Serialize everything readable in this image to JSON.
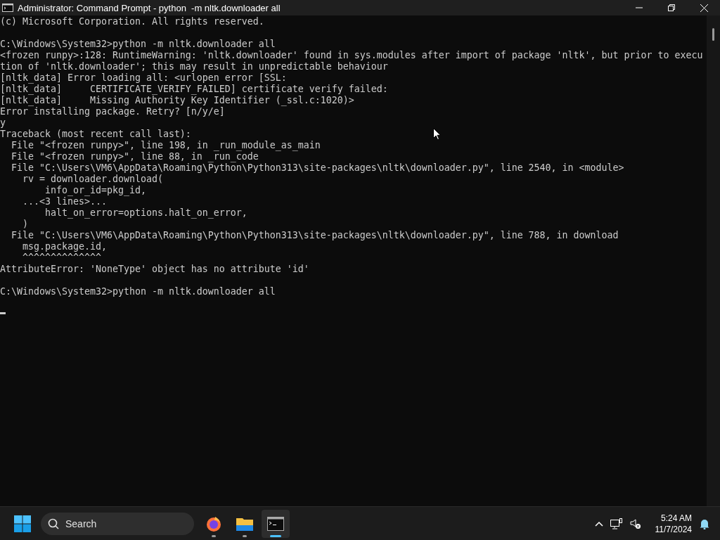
{
  "window": {
    "title": "Administrator: Command Prompt - python  -m nltk.downloader all"
  },
  "terminal": {
    "lines": [
      {
        "kind": "text",
        "text": "(c) Microsoft Corporation. All rights reserved."
      },
      {
        "kind": "blank"
      },
      {
        "kind": "text",
        "text": "C:\\Windows\\System32>python -m nltk.downloader all"
      },
      {
        "kind": "text",
        "text": "<frozen runpy>:128: RuntimeWarning: 'nltk.downloader' found in sys.modules after import of package 'nltk', but prior to execu"
      },
      {
        "kind": "text",
        "text": "tion of 'nltk.downloader'; this may result in unpredictable behaviour"
      },
      {
        "kind": "text",
        "text": "[nltk_data] Error loading all: <urlopen error [SSL:"
      },
      {
        "kind": "text",
        "text": "[nltk_data]     CERTIFICATE_VERIFY_FAILED] certificate verify failed:"
      },
      {
        "kind": "text",
        "text": "[nltk_data]     Missing Authority Key Identifier (_ssl.c:1020)>"
      },
      {
        "kind": "text",
        "text": "Error installing package. Retry? [n/y/e]"
      },
      {
        "kind": "text",
        "text": "y"
      },
      {
        "kind": "text",
        "text": "Traceback (most recent call last):"
      },
      {
        "kind": "text",
        "text": "  File \"<frozen runpy>\", line 198, in _run_module_as_main"
      },
      {
        "kind": "text",
        "text": "  File \"<frozen runpy>\", line 88, in _run_code"
      },
      {
        "kind": "text",
        "text": "  File \"C:\\Users\\VM6\\AppData\\Roaming\\Python\\Python313\\site-packages\\nltk\\downloader.py\", line 2540, in <module>"
      },
      {
        "kind": "text",
        "text": "    rv = downloader.download("
      },
      {
        "kind": "text",
        "text": "        info_or_id=pkg_id,"
      },
      {
        "kind": "text",
        "text": "    ...<3 lines>..."
      },
      {
        "kind": "text",
        "text": "        halt_on_error=options.halt_on_error,"
      },
      {
        "kind": "text",
        "text": "    )"
      },
      {
        "kind": "text",
        "text": "  File \"C:\\Users\\VM6\\AppData\\Roaming\\Python\\Python313\\site-packages\\nltk\\downloader.py\", line 788, in download"
      },
      {
        "kind": "text",
        "text": "    msg.package.id,"
      },
      {
        "kind": "text",
        "text": "    ^^^^^^^^^^^^^^"
      },
      {
        "kind": "text",
        "text": "AttributeError: 'NoneType' object has no attribute 'id'"
      },
      {
        "kind": "blank"
      },
      {
        "kind": "text",
        "text": "C:\\Windows\\System32>python -m nltk.downloader all"
      },
      {
        "kind": "blank"
      }
    ],
    "cursor": true
  },
  "taskbar": {
    "search": {
      "placeholder": "Search"
    },
    "apps": [
      {
        "kind": "firefox",
        "running": true,
        "selected": false
      },
      {
        "kind": "files",
        "running": true,
        "selected": false
      },
      {
        "kind": "terminal",
        "running": true,
        "selected": true
      }
    ],
    "clock": {
      "time": "5:24 AM",
      "date": "11/7/2024"
    }
  }
}
